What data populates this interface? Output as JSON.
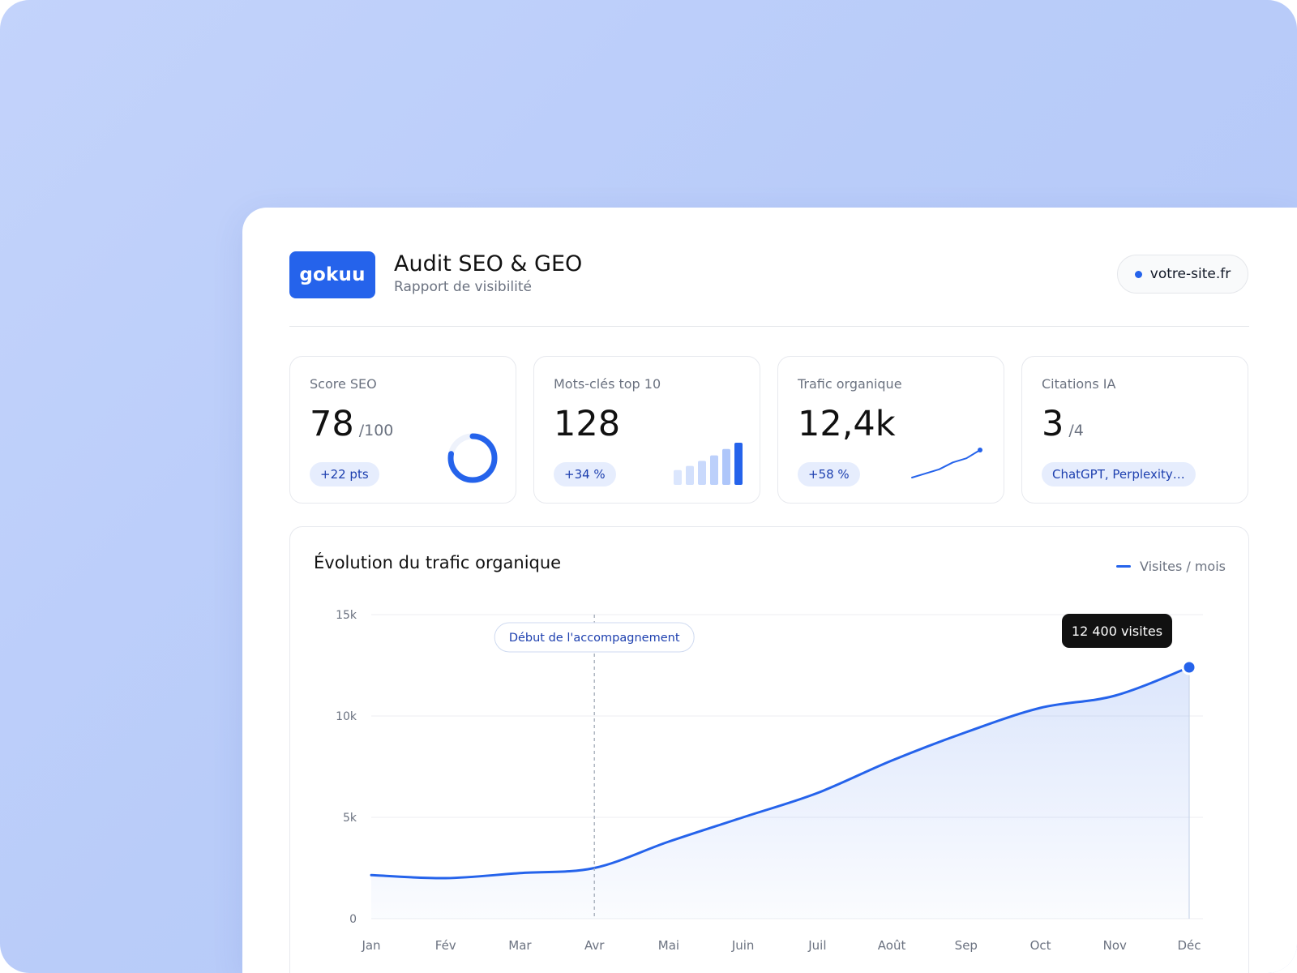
{
  "brand": {
    "logo_text": "gokuu",
    "accent": "#2563eb"
  },
  "header": {
    "title": "Audit SEO & GEO",
    "subtitle": "Rapport de visibilité",
    "site": "votre-site.fr"
  },
  "kpis": [
    {
      "label": "Score SEO",
      "value": "78",
      "unit": "/100",
      "badge": "+22 pts",
      "viz": "donut",
      "score_fraction": 0.78
    },
    {
      "label": "Mots-clés top 10",
      "value": "128",
      "unit": "",
      "badge": "+34 %",
      "viz": "bars",
      "bar_levels": [
        0.35,
        0.45,
        0.57,
        0.7,
        0.85,
        1.0
      ]
    },
    {
      "label": "Trafic organique",
      "value": "12,4k",
      "unit": "",
      "badge": "+58 %",
      "viz": "sparkline",
      "spark_values": [
        0.0,
        0.15,
        0.3,
        0.55,
        0.7,
        1.0
      ]
    },
    {
      "label": "Citations IA",
      "value": "3",
      "unit": "/4",
      "badge": "ChatGPT, Perplexity…",
      "viz": "none"
    }
  ],
  "chart": {
    "title": "Évolution du trafic organique",
    "legend": "Visites / mois",
    "marker_label": "Début de l'accompagnement",
    "tooltip": "12 400 visites"
  },
  "chart_data": {
    "type": "area",
    "title": "Évolution du trafic organique",
    "xlabel": "",
    "ylabel": "",
    "categories": [
      "Jan",
      "Fév",
      "Mar",
      "Avr",
      "Mai",
      "Juin",
      "Juil",
      "Août",
      "Sep",
      "Oct",
      "Nov",
      "Déc"
    ],
    "series": [
      {
        "name": "Visites / mois",
        "values": [
          2150,
          2000,
          2250,
          2500,
          3800,
          5000,
          6200,
          7800,
          9200,
          10400,
          11000,
          12400
        ]
      }
    ],
    "ylim": [
      0,
      15000
    ],
    "yticks": [
      0,
      5000,
      10000,
      15000
    ],
    "ytick_labels": [
      "0",
      "5k",
      "10k",
      "15k"
    ],
    "vertical_marker": {
      "x": "Avr",
      "label": "Début de l'accompagnement"
    },
    "highlight": {
      "x": "Déc",
      "label": "12 400 visites"
    },
    "grid": true,
    "legend_position": "top-right"
  }
}
